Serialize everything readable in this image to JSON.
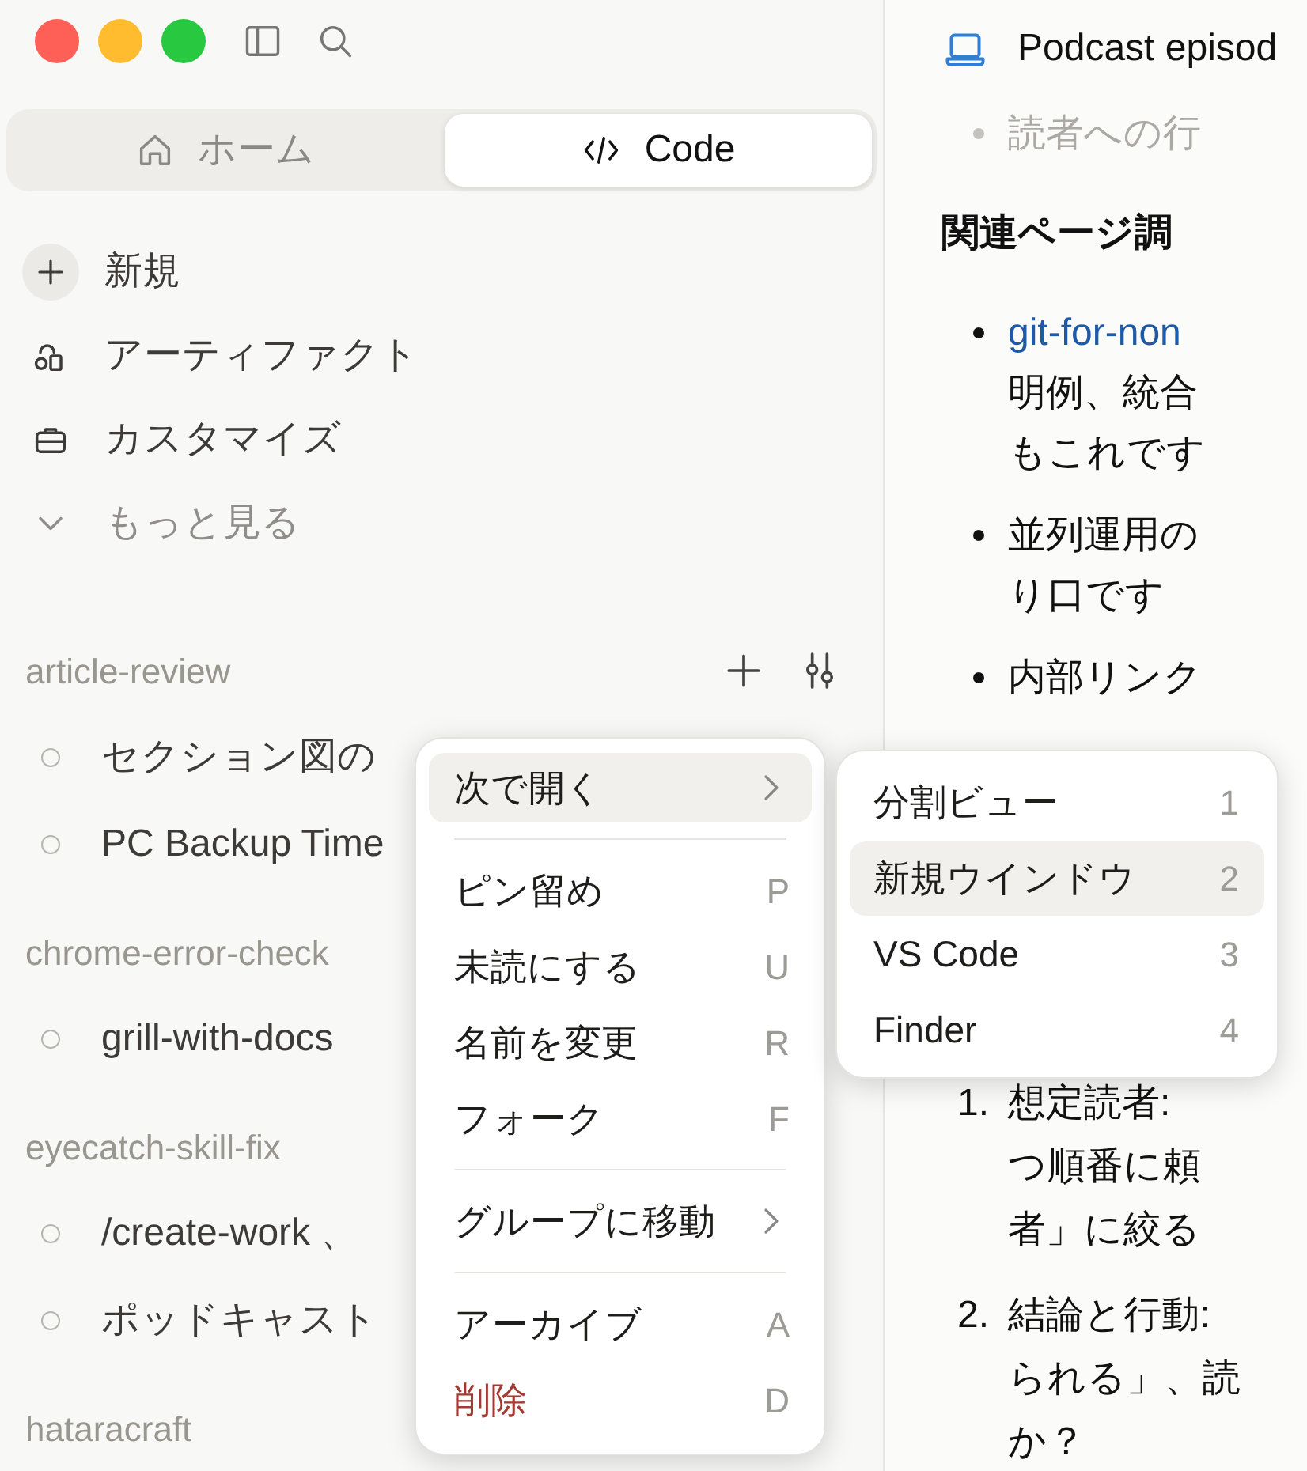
{
  "mode_tabs": [
    {
      "label": "ホーム",
      "kind": "home",
      "selected": false
    },
    {
      "label": "Code",
      "kind": "code",
      "selected": true
    }
  ],
  "nav": [
    {
      "label": "新規",
      "kind": "new"
    },
    {
      "label": "アーティファクト",
      "kind": "artifacts"
    },
    {
      "label": "カスタマイズ",
      "kind": "customize"
    },
    {
      "label": "もっと見る",
      "kind": "more"
    }
  ],
  "groups": [
    {
      "name": "article-review",
      "show_actions": true,
      "chats": [
        "セクション図の",
        "PC Backup Time"
      ]
    },
    {
      "name": "chrome-error-check",
      "show_actions": false,
      "chats": [
        "grill-with-docs"
      ]
    },
    {
      "name": "eyecatch-skill-fix",
      "show_actions": false,
      "chats": [
        "/create-work 、",
        "ポッドキャスト"
      ]
    },
    {
      "name": "hataracraft",
      "show_actions": false
    }
  ],
  "document": {
    "title": "Podcast episod",
    "blocks": [
      {
        "kind": "bullet",
        "muted": true,
        "lines": [
          "読者への行"
        ]
      },
      {
        "kind": "heading",
        "text": "関連ページ調"
      },
      {
        "kind": "bullet",
        "muted": false,
        "link": "git-for-non",
        "lines": [
          "明例、統合",
          "もこれです"
        ]
      },
      {
        "kind": "bullet",
        "muted": false,
        "lines": [
          "並列運用の",
          "り口です"
        ]
      },
      {
        "kind": "bullet",
        "muted": false,
        "lines": [
          "内部リンク"
        ]
      }
    ],
    "numbered": [
      {
        "number": "1.",
        "lines": [
          "想定読者:",
          "つ順番に頼",
          "者」に絞る"
        ]
      },
      {
        "number": "2.",
        "lines": [
          "結論と行動:",
          "られる」、読",
          "か？"
        ]
      }
    ]
  },
  "context_menu": {
    "items": [
      {
        "kind": "submenu",
        "label": "次で開く",
        "selected": true
      },
      {
        "kind": "separator"
      },
      {
        "kind": "item",
        "label": "ピン留め",
        "shortcut": "P",
        "selected": false,
        "destructive": false
      },
      {
        "kind": "item",
        "label": "未読にする",
        "shortcut": "U",
        "selected": false,
        "destructive": false
      },
      {
        "kind": "item",
        "label": "名前を変更",
        "shortcut": "R",
        "selected": false,
        "destructive": false
      },
      {
        "kind": "item",
        "label": "フォーク",
        "shortcut": "F",
        "selected": false,
        "destructive": false
      },
      {
        "kind": "separator"
      },
      {
        "kind": "submenu",
        "label": "グループに移動",
        "selected": false
      },
      {
        "kind": "separator"
      },
      {
        "kind": "item",
        "label": "アーカイブ",
        "shortcut": "A",
        "selected": false,
        "destructive": false
      },
      {
        "kind": "item",
        "label": "削除",
        "shortcut": "D",
        "selected": false,
        "destructive": true
      }
    ]
  },
  "submenu": {
    "items": [
      {
        "label": "分割ビュー",
        "shortcut": "1",
        "selected": false
      },
      {
        "label": "新規ウインドウ",
        "shortcut": "2",
        "selected": true
      },
      {
        "label": "VS Code",
        "shortcut": "3",
        "selected": false
      },
      {
        "label": "Finder",
        "shortcut": "4",
        "selected": false
      }
    ]
  }
}
